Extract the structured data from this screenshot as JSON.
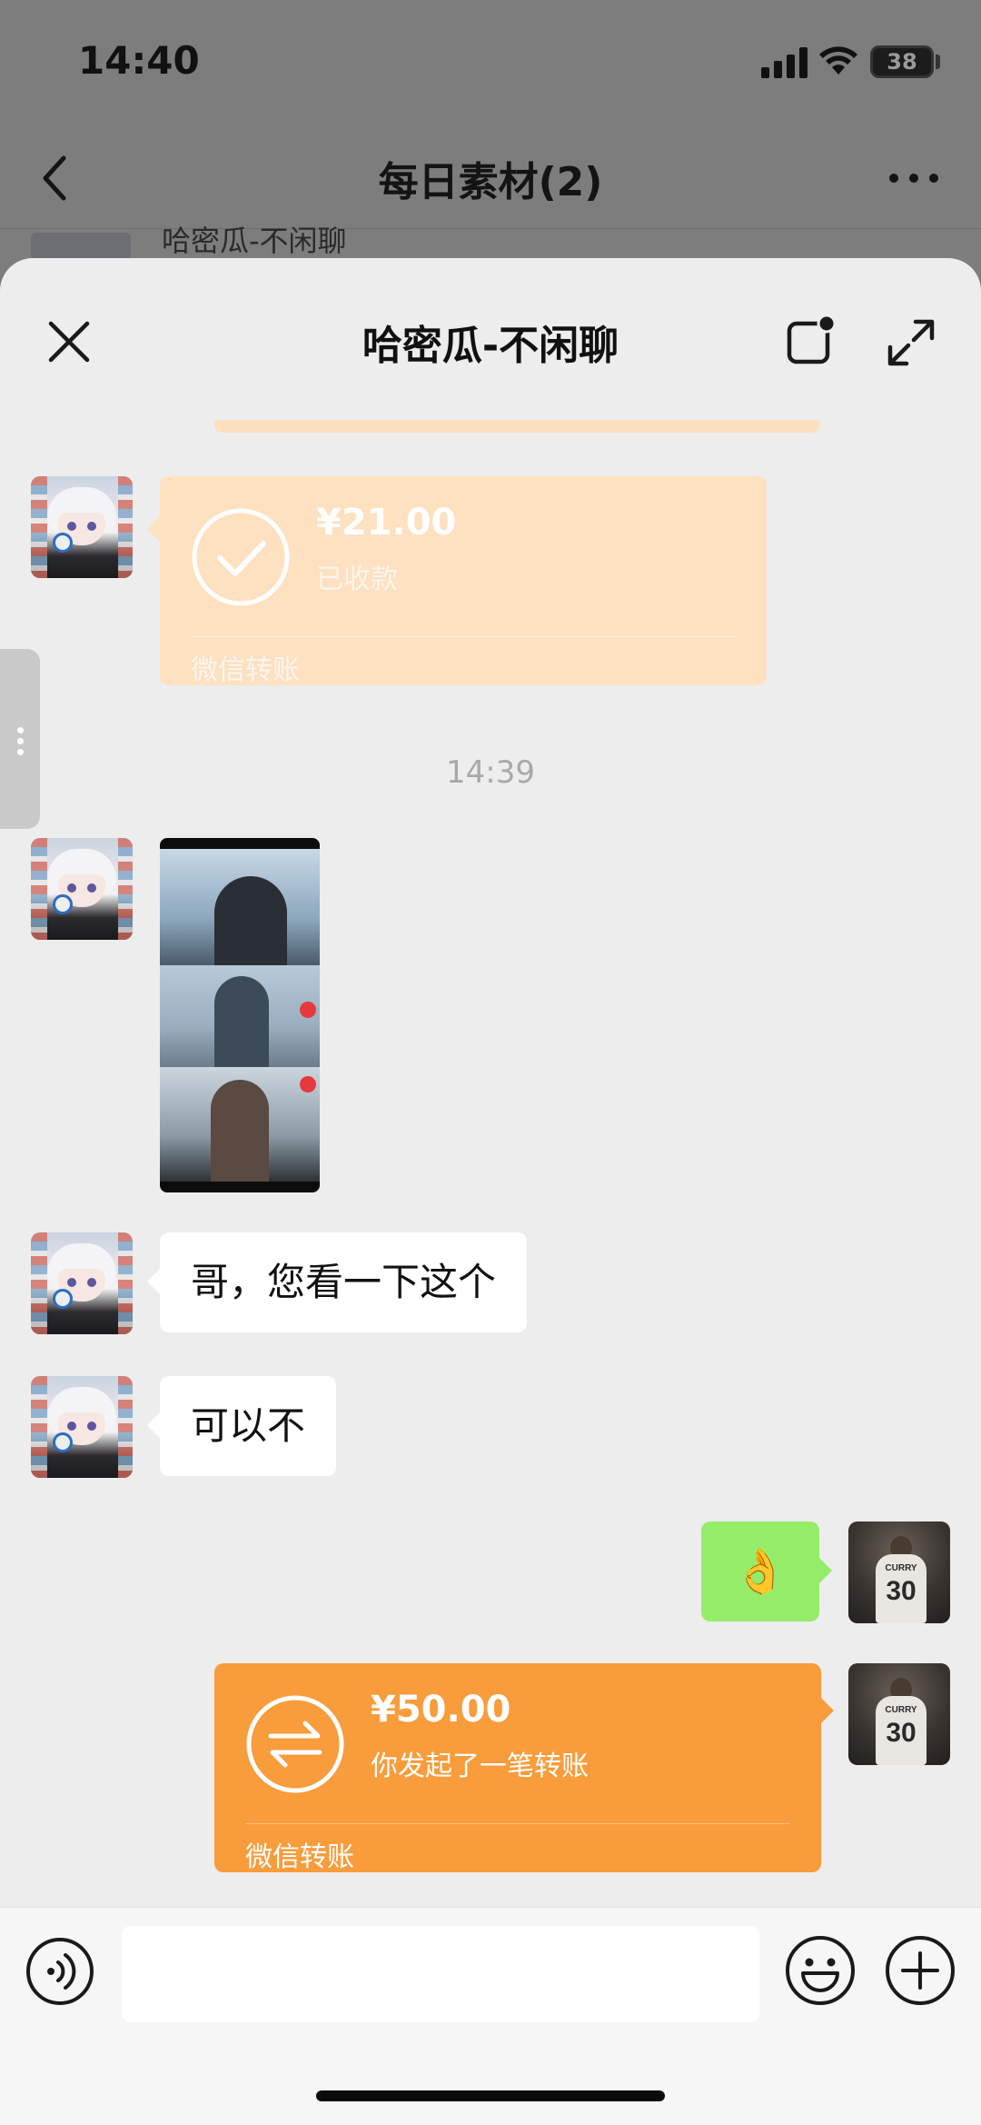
{
  "status_bar": {
    "time": "14:40",
    "battery": "38"
  },
  "background_chat": {
    "title": "每日素材(2)",
    "peek_text": "哈密瓜-不闲聊"
  },
  "sheet": {
    "title": "哈密瓜-不闲聊"
  },
  "messages": {
    "transfer_received": {
      "amount": "¥21.00",
      "status": "已收款",
      "label": "微信转账"
    },
    "time_separator": "14:39",
    "text_1": "哥，您看一下这个",
    "text_2": "可以不",
    "sent_emoji": "👌",
    "transfer_sent": {
      "amount": "¥50.00",
      "status": "你发起了一笔转账",
      "label": "微信转账"
    }
  },
  "input": {
    "placeholder": "",
    "value": ""
  },
  "colors": {
    "transfer_received_bg": "#fde1c0",
    "transfer_sent_bg": "#f89c3c",
    "sent_bubble_bg": "#95ec69",
    "sheet_bg": "#ededed"
  },
  "icons": {
    "back": "chevron-left-icon",
    "more": "more-horizontal-icon",
    "close": "close-icon",
    "float": "floating-window-icon",
    "expand": "expand-icon",
    "check": "check-icon",
    "transfer": "transfer-arrows-icon",
    "voice": "voice-icon",
    "emoji": "emoji-icon",
    "plus": "plus-icon"
  }
}
